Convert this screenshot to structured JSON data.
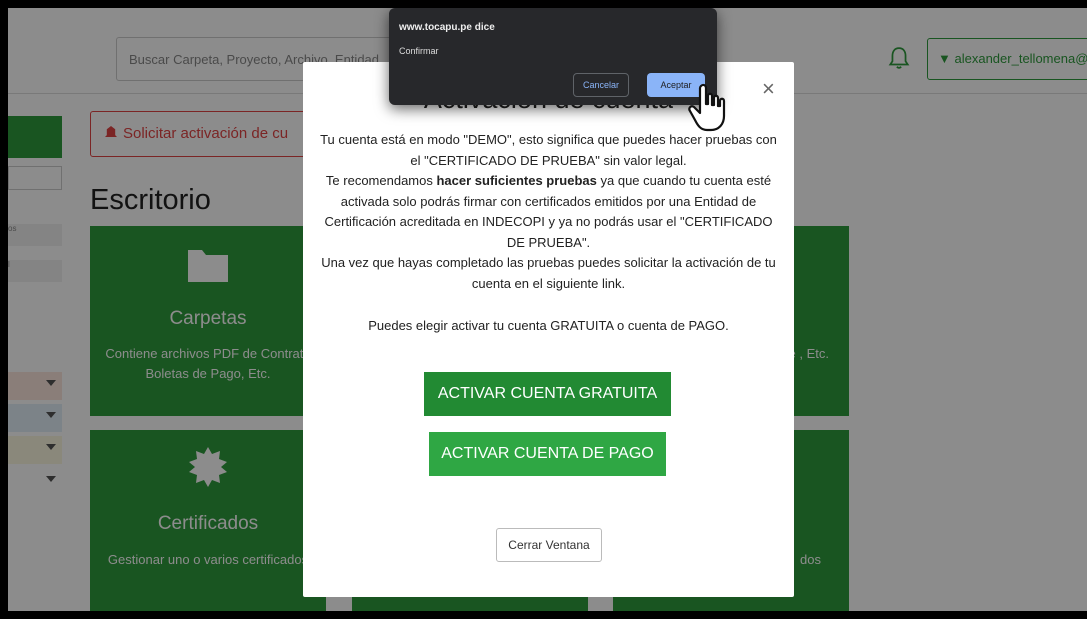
{
  "header": {
    "search_placeholder": "Buscar Carpeta, Proyecto, Archivo, Entidad",
    "user_label": "alexander_tellomena@hot"
  },
  "sidebar": {
    "rows": [
      "os",
      "l"
    ]
  },
  "main": {
    "alert_text": "Solicitar activación de cu",
    "page_title": "Escritorio",
    "cards": [
      {
        "title": "Carpetas",
        "desc": "Contiene archivos PDF de Contrato Boletas de Pago, Etc.",
        "icon": "folder-icon"
      },
      {
        "title": "Certificados",
        "desc": "Gestionar uno o varios certificados",
        "icon": "gear-icon"
      },
      {
        "desc": "F de , Etc."
      },
      {
        "desc": "dos"
      }
    ]
  },
  "modal": {
    "title": "Activación de cuenta",
    "p1": "Tu cuenta está en modo \"DEMO\", esto significa que puedes hacer pruebas con el \"CERTIFICADO DE PRUEBA\" sin valor legal.",
    "p2_before": "Te recomendamos ",
    "p2_bold": "hacer suficientes pruebas",
    "p2_after": " ya que cuando tu cuenta esté activada solo podrás firmar con certificados emitidos por una Entidad de Certificación acreditada en INDECOPI y ya no podrás usar el \"CERTIFICADO DE PRUEBA\".",
    "p3": "Una vez que hayas completado las pruebas puedes solicitar la activación de tu cuenta en el siguiente link.",
    "p4": "Puedes elegir activar tu cuenta GRATUITA o cuenta de PAGO.",
    "btn_free": "ACTIVAR CUENTA GRATUITA",
    "btn_pay": "ACTIVAR CUENTA DE PAGO",
    "btn_close": "Cerrar Ventana",
    "close_symbol": "×"
  },
  "confirm_dialog": {
    "origin": "www.tocapu.pe dice",
    "message": "Confirmar",
    "cancel": "Cancelar",
    "ok": "Aceptar"
  },
  "colors": {
    "brand_green": "#2e9b3c",
    "alert_red": "#e04444",
    "dialog_bg": "#27282b",
    "dialog_accent": "#8ab4f8"
  }
}
